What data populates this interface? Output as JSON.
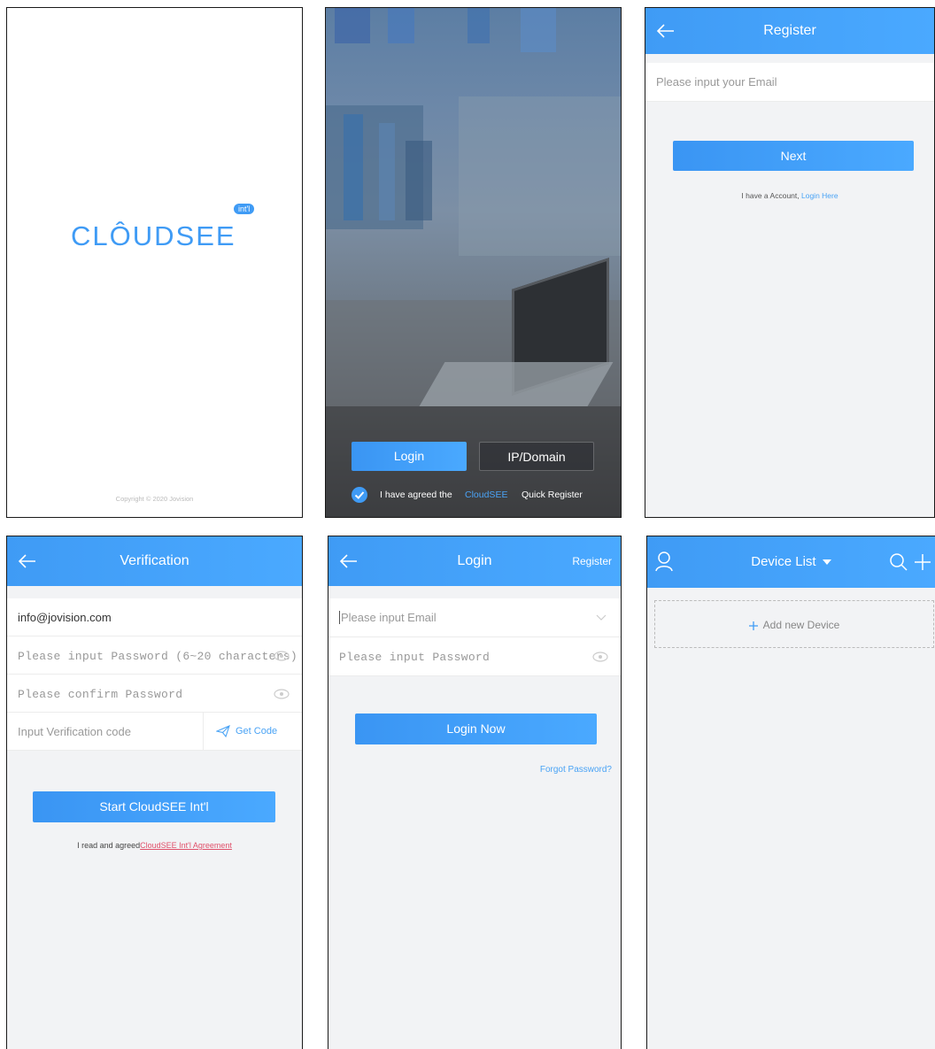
{
  "splash": {
    "logo_text": "CLÔUDSEE",
    "logo_badge": "int'l",
    "copyright": "Copyright © 2020 Jovision"
  },
  "landing": {
    "login_label": "Login",
    "ip_domain_label": "IP/Domain",
    "agree_text": "I have agreed the",
    "agree_link": "CloudSEE",
    "quick_register": "Quick Register"
  },
  "register": {
    "title": "Register",
    "email_placeholder": "Please input your Email",
    "next_label": "Next",
    "have_account": "I have a Account,",
    "login_here": "Login Here"
  },
  "verification": {
    "title": "Verification",
    "email_value": "info@jovision.com",
    "password_placeholder": "Please input Password (6~20 characters)",
    "confirm_placeholder": "Please confirm Password",
    "code_placeholder": "Input Verification code",
    "get_code_label": "Get Code",
    "start_label": "Start CloudSEE Int'l",
    "agree_text": "I read and agreed",
    "agree_link": "CloudSEE Int'l Agreement"
  },
  "login": {
    "title": "Login",
    "register_label": "Register",
    "email_placeholder": "Please input Email",
    "password_placeholder": "Please input Password",
    "login_now_label": "Login Now",
    "forgot_label": "Forgot Password?"
  },
  "device_list": {
    "title": "Device List",
    "add_device_label": "Add new Device"
  },
  "colors": {
    "accent": "#3f9bf5",
    "link": "#4aa3f5",
    "agreement_link": "#e0506a"
  }
}
